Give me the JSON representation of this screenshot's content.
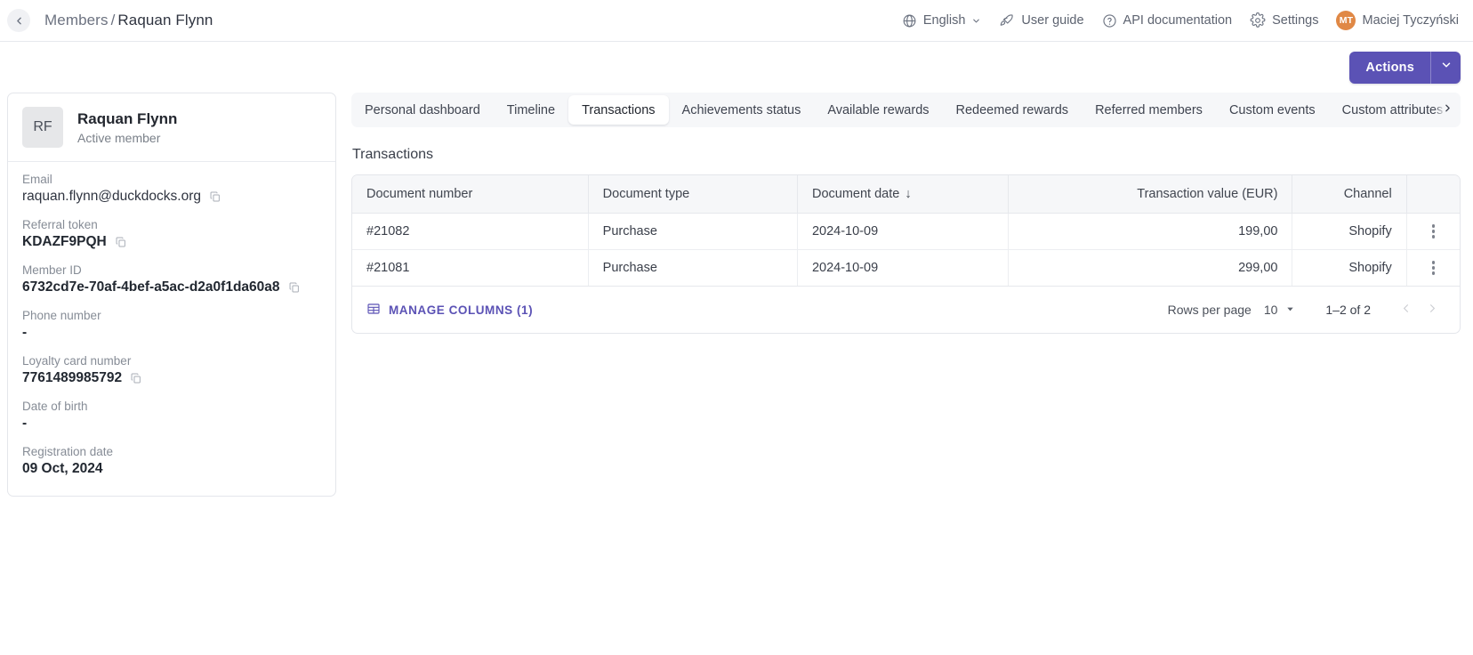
{
  "topbar": {
    "back_icon": "chevron-left-icon",
    "breadcrumb": {
      "parent": "Members",
      "separator": "/",
      "current": "Raquan Flynn"
    },
    "items": [
      {
        "icon": "globe-icon",
        "label": "English",
        "caret": "chevron-down-icon"
      },
      {
        "icon": "rocket-icon",
        "label": "User guide"
      },
      {
        "icon": "question-circle-icon",
        "label": "API documentation"
      },
      {
        "icon": "gear-icon",
        "label": "Settings"
      }
    ],
    "user": {
      "initials": "MT",
      "name": "Maciej Tyczyński",
      "avatar_color": "#e08845"
    }
  },
  "actionbar": {
    "actions_label": "Actions",
    "caret_icon": "chevron-down-icon",
    "accent_color": "#5b52b5"
  },
  "sidebar": {
    "avatar_initials": "RF",
    "name": "Raquan Flynn",
    "status": "Active member",
    "fields": [
      {
        "label": "Email",
        "value": "raquan.flynn@duckdocks.org",
        "copyable": true,
        "bold": false
      },
      {
        "label": "Referral token",
        "value": "KDAZF9PQH",
        "copyable": true,
        "bold": true
      },
      {
        "label": "Member ID",
        "value": "6732cd7e-70af-4bef-a5ac-d2a0f1da60a8",
        "copyable": true,
        "bold": true
      },
      {
        "label": "Phone number",
        "value": "-",
        "copyable": false,
        "bold": true
      },
      {
        "label": "Loyalty card number",
        "value": "7761489985792",
        "copyable": true,
        "bold": true
      },
      {
        "label": "Date of birth",
        "value": "-",
        "copyable": false,
        "bold": true
      },
      {
        "label": "Registration date",
        "value": "09 Oct, 2024",
        "copyable": false,
        "bold": true
      }
    ]
  },
  "tabs": {
    "items": [
      {
        "label": "Personal dashboard",
        "active": false
      },
      {
        "label": "Timeline",
        "active": false
      },
      {
        "label": "Transactions",
        "active": true
      },
      {
        "label": "Achievements status",
        "active": false
      },
      {
        "label": "Available rewards",
        "active": false
      },
      {
        "label": "Redeemed rewards",
        "active": false
      },
      {
        "label": "Referred members",
        "active": false
      },
      {
        "label": "Custom events",
        "active": false
      },
      {
        "label": "Custom attributes",
        "active": false
      }
    ],
    "scroll_right_icon": "chevron-right-icon"
  },
  "transactions": {
    "section_title": "Transactions",
    "columns": [
      {
        "key": "document_number",
        "label": "Document number",
        "align": "left",
        "sorted": false
      },
      {
        "key": "document_type",
        "label": "Document type",
        "align": "left",
        "sorted": false
      },
      {
        "key": "document_date",
        "label": "Document date",
        "align": "left",
        "sorted": true,
        "sort_dir": "↓"
      },
      {
        "key": "transaction_value",
        "label": "Transaction value (EUR)",
        "align": "right",
        "sorted": false
      },
      {
        "key": "channel",
        "label": "Channel",
        "align": "right",
        "sorted": false
      },
      {
        "key": "actions",
        "label": "",
        "align": "center",
        "sorted": false
      }
    ],
    "rows": [
      {
        "document_number": "#21082",
        "document_type": "Purchase",
        "document_date": "2024-10-09",
        "transaction_value": "199,00",
        "channel": "Shopify",
        "actions_icon": "kebab-menu-icon"
      },
      {
        "document_number": "#21081",
        "document_type": "Purchase",
        "document_date": "2024-10-09",
        "transaction_value": "299,00",
        "channel": "Shopify",
        "actions_icon": "kebab-menu-icon"
      }
    ],
    "footer": {
      "manage_columns_icon": "table-columns-icon",
      "manage_columns_label": "MANAGE COLUMNS (1)",
      "manage_columns_color": "#5b52b5",
      "rows_per_page_label": "Rows per page",
      "rows_per_page_value": "10",
      "rows_per_page_caret": "chevron-down-icon",
      "range_label": "1–2 of 2",
      "prev_icon": "chevron-left-icon",
      "next_icon": "chevron-right-icon"
    }
  }
}
